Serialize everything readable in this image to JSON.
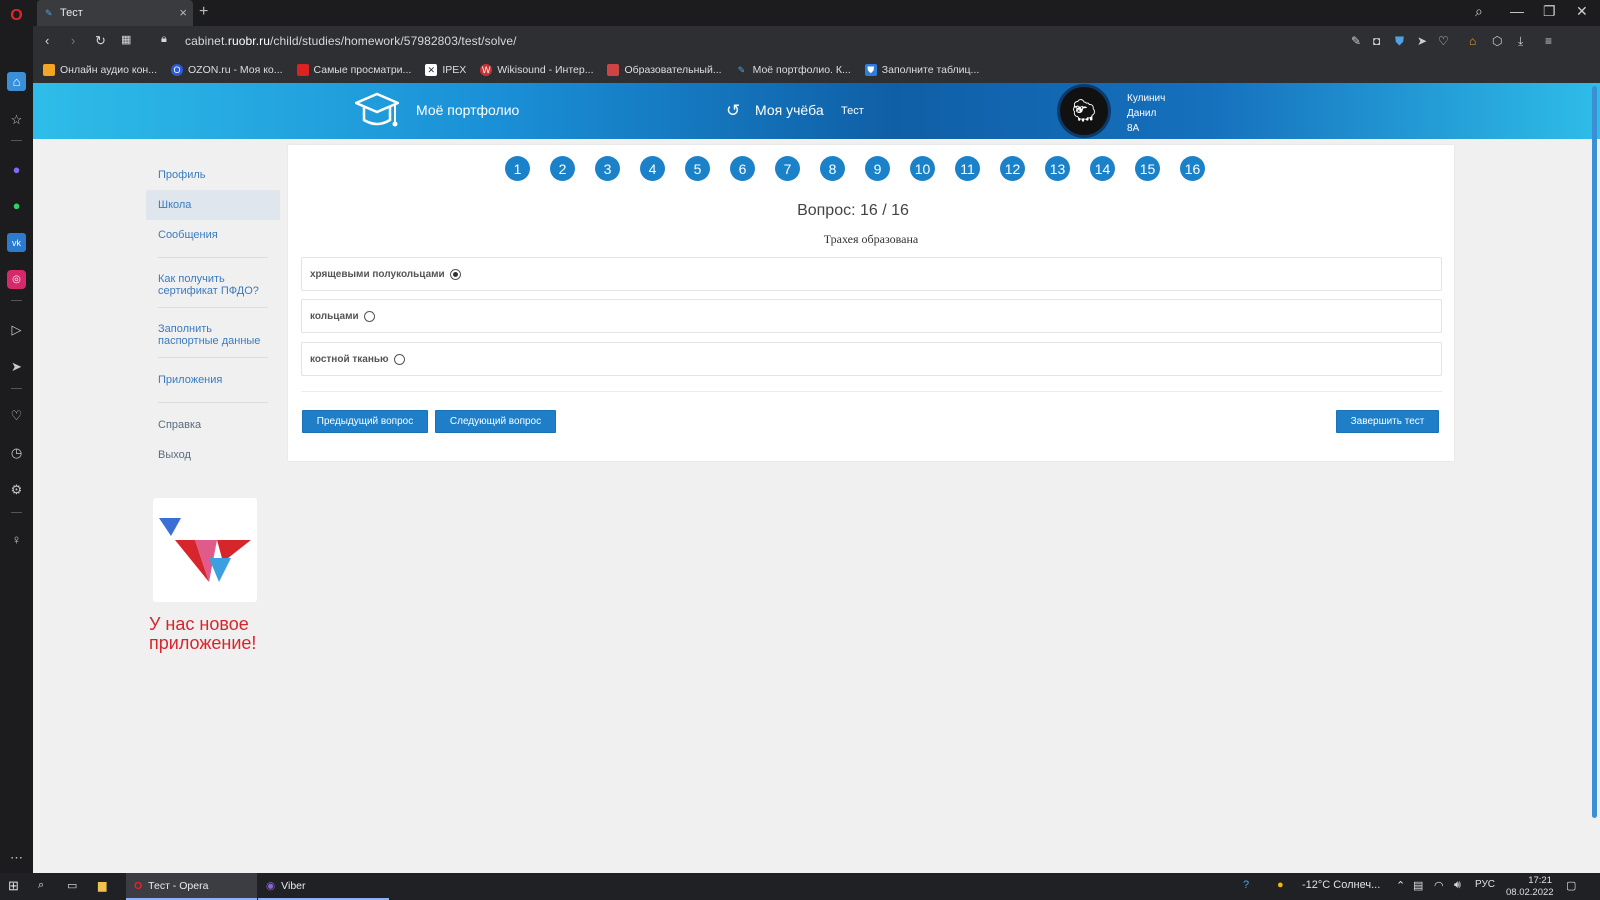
{
  "browser": {
    "tab_title": "Тест",
    "url_prefix": "cabinet.",
    "url_domain": "ruobr.ru",
    "url_path": "/child/studies/homework/57982803/test/solve/",
    "bookmarks": [
      {
        "label": "Онлайн аудио кон...",
        "color": "#f3a623",
        "icon": "multicolor-dots-icon"
      },
      {
        "label": "OZON.ru - Моя ко...",
        "color": "#2b5bd8",
        "icon": "ozon-icon"
      },
      {
        "label": "Самые просматри...",
        "color": "#d22",
        "icon": "video-icon"
      },
      {
        "label": "IPEX",
        "color": "#345",
        "icon": "ipex-icon"
      },
      {
        "label": "Wikisound - Интер...",
        "color": "#c33",
        "icon": "wikisound-icon"
      },
      {
        "label": "Образовательный...",
        "color": "#c44",
        "icon": "edu-icon"
      },
      {
        "label": "Моё портфолио. К...",
        "color": "#4ea3e6",
        "icon": "portfolio-icon"
      },
      {
        "label": "Заполните таблиц...",
        "color": "#2a7de1",
        "icon": "shield-icon"
      }
    ]
  },
  "header": {
    "portfolio_label": "Моё портфолио",
    "study_label": "Моя учёба",
    "test_label": "Тест",
    "user_name_1": "Кулинич",
    "user_name_2": "Данил",
    "user_class": "8А"
  },
  "sidebar": {
    "items": [
      {
        "label": "Профиль"
      },
      {
        "label": "Школа"
      },
      {
        "label": "Сообщения"
      },
      {
        "label": "Как получить сертификат ПФДО?"
      },
      {
        "label": "Заполнить паспортные данные"
      },
      {
        "label": "Приложения"
      },
      {
        "label": "Справка"
      },
      {
        "label": "Выход"
      }
    ],
    "promo_text": "У нас новое приложение!"
  },
  "test": {
    "question_numbers": [
      "1",
      "2",
      "3",
      "4",
      "5",
      "6",
      "7",
      "8",
      "9",
      "10",
      "11",
      "12",
      "13",
      "14",
      "15",
      "16"
    ],
    "counter": "Вопрос: 16 / 16",
    "question": "Трахея образована",
    "options": [
      {
        "label": "хрящевыми полукольцами",
        "selected": true
      },
      {
        "label": "кольцами",
        "selected": false
      },
      {
        "label": "костной тканью",
        "selected": false
      }
    ],
    "prev_label": "Предыдущий вопрос",
    "next_label": "Следующий вопрос",
    "finish_label": "Завершить тест"
  },
  "taskbar": {
    "app1": "Тест - Opera",
    "app2": "Viber",
    "weather": "-12°C Солнеч...",
    "lang": "РУС",
    "time": "17:21",
    "date": "08.02.2022"
  },
  "colors": {
    "accent": "#1e7fc8",
    "promo": "#d6262c"
  }
}
